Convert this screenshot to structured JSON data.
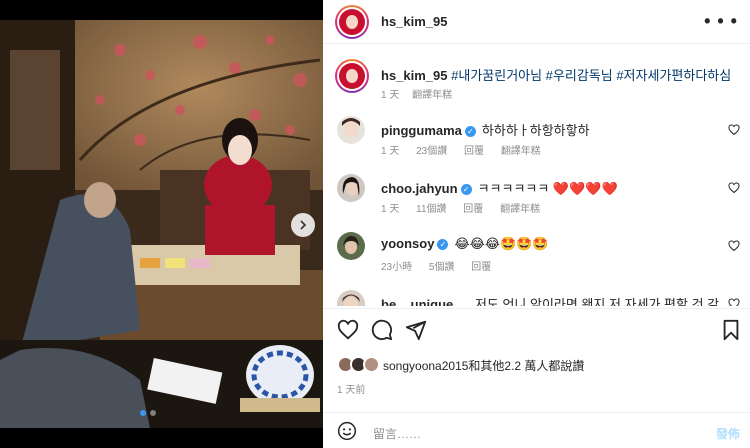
{
  "post": {
    "username": "hs_kim_95",
    "caption_tags": "#내가꿈린거아님 #우리감독님 #저자세가편하다하심",
    "caption_age": "1 天",
    "caption_translate": "翻譯年糕"
  },
  "comments": [
    {
      "username": "pinggumama",
      "text": "하하하ㅏ하항하핳하",
      "age": "1 天",
      "likes": "23個讚",
      "reply": "回覆",
      "translate": "翻譯年糕",
      "verified": true
    },
    {
      "username": "choo.jahyun",
      "text": "ㅋㅋㅋㅋㅋㅋ ❤️❤️❤️❤️",
      "age": "1 天",
      "likes": "11個讚",
      "reply": "回覆",
      "translate": "翻譯年糕",
      "verified": true
    },
    {
      "username": "yoonsoy",
      "text": "😂😂😂🤩🤩🤩",
      "age": "23小時",
      "likes": "5個讚",
      "reply": "回覆",
      "verified": true
    },
    {
      "username": "be__unique.__",
      "text": "저도 언니 앞이라면 왠지 저 자세가 편할 것 같"
    }
  ],
  "likes_text": "songyoona2015和其他2.2 萬人都說讚",
  "post_time": "1 天前",
  "add_comment": {
    "placeholder": "留言……",
    "post_label": "發佈"
  },
  "icons": {
    "like": "heart-icon",
    "comment": "comment-icon",
    "share": "share-icon",
    "save": "bookmark-icon",
    "more": "more-icon",
    "next": "chevron-right-icon",
    "emoji": "emoji-icon"
  },
  "colors": {
    "link": "#00376b",
    "verified": "#3897f0",
    "post_button": "#b2dffc"
  }
}
